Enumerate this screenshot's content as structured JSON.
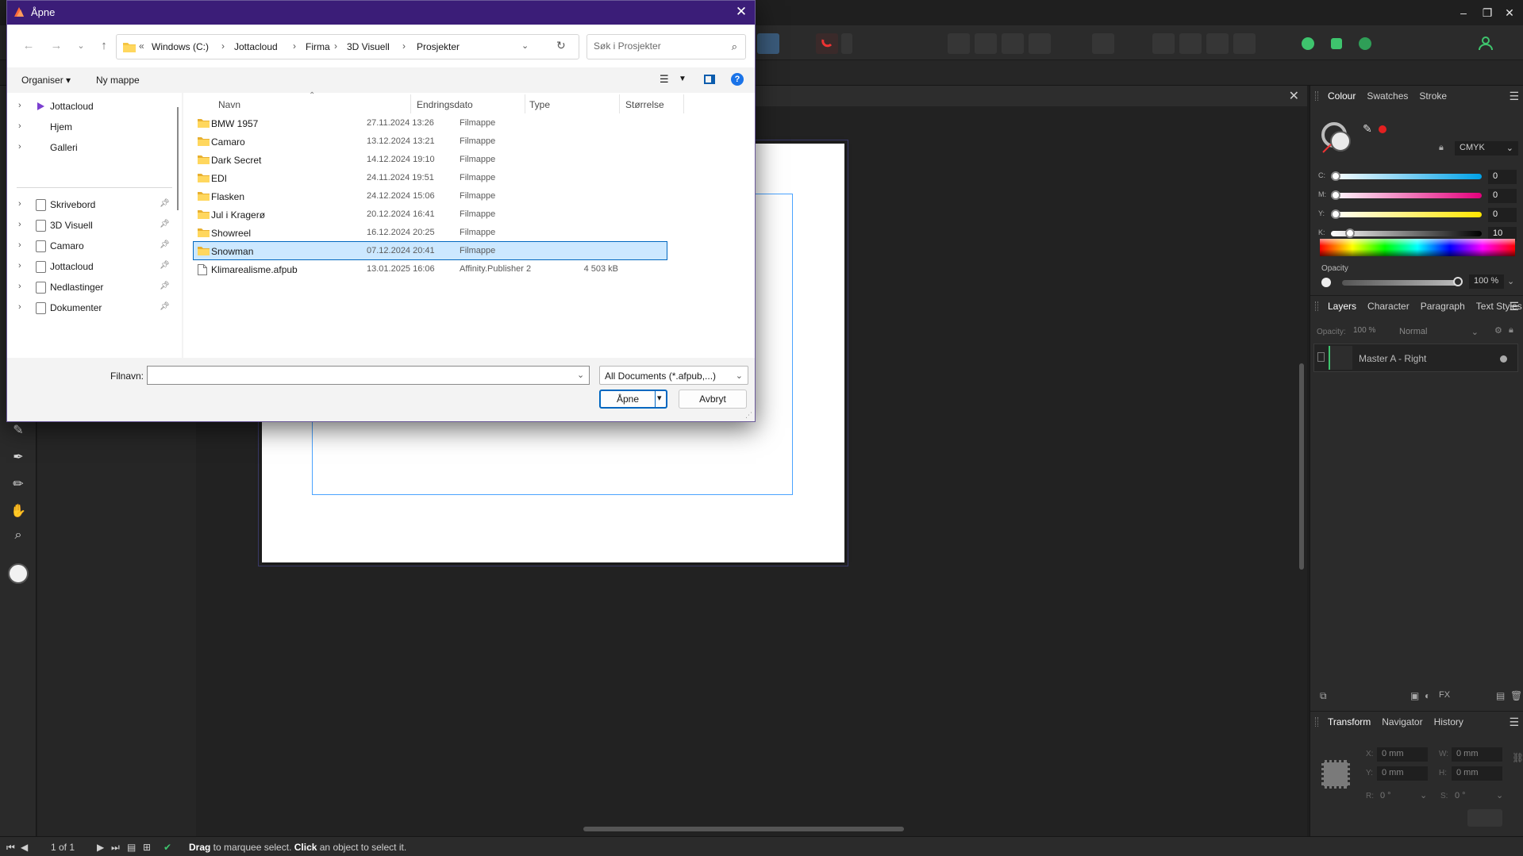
{
  "dialog": {
    "title": "Åpne",
    "breadcrumb": [
      "Windows (C:)",
      "Jottacloud",
      "Firma",
      "3D Visuell",
      "Prosjekter"
    ],
    "breadcrumb_overflow": "«",
    "search_placeholder": "Søk i Prosjekter",
    "commands": {
      "organize": "Organiser ▾",
      "new_folder": "Ny mappe"
    },
    "nav_top": [
      {
        "label": "Jottacloud",
        "icon": "jottacloud-icon"
      },
      {
        "label": "Hjem",
        "icon": "home-icon"
      },
      {
        "label": "Galleri",
        "icon": "gallery-icon"
      }
    ],
    "nav_quick": [
      {
        "label": "Skrivebord",
        "icon": "folder-icon"
      },
      {
        "label": "3D Visuell",
        "icon": "folder-icon"
      },
      {
        "label": "Camaro",
        "icon": "folder-icon"
      },
      {
        "label": "Jottacloud",
        "icon": "folder-icon"
      },
      {
        "label": "Nedlastinger",
        "icon": "folder-icon"
      },
      {
        "label": "Dokumenter",
        "icon": "folder-icon"
      }
    ],
    "columns": {
      "name": "Navn",
      "date": "Endringsdato",
      "type": "Type",
      "size": "Størrelse"
    },
    "files": [
      {
        "name": "BMW 1957",
        "date": "27.11.2024 13:26",
        "type": "Filmappe",
        "size": "",
        "kind": "folder"
      },
      {
        "name": "Camaro",
        "date": "13.12.2024 13:21",
        "type": "Filmappe",
        "size": "",
        "kind": "folder"
      },
      {
        "name": "Dark Secret",
        "date": "14.12.2024 19:10",
        "type": "Filmappe",
        "size": "",
        "kind": "folder"
      },
      {
        "name": "EDI",
        "date": "24.11.2024 19:51",
        "type": "Filmappe",
        "size": "",
        "kind": "folder"
      },
      {
        "name": "Flasken",
        "date": "24.12.2024 15:06",
        "type": "Filmappe",
        "size": "",
        "kind": "folder"
      },
      {
        "name": "Jul i Kragerø",
        "date": "20.12.2024 16:41",
        "type": "Filmappe",
        "size": "",
        "kind": "folder"
      },
      {
        "name": "Showreel",
        "date": "16.12.2024 20:25",
        "type": "Filmappe",
        "size": "",
        "kind": "folder"
      },
      {
        "name": "Snowman",
        "date": "07.12.2024 20:41",
        "type": "Filmappe",
        "size": "",
        "kind": "folder",
        "selected": true
      },
      {
        "name": "Klimarealisme.afpub",
        "date": "13.01.2025 16:06",
        "type": "Affinity.Publisher 2",
        "size": "4 503 kB",
        "kind": "file"
      }
    ],
    "filename_label": "Filnavn:",
    "filename_value": "",
    "filter": "All Documents (*.afpub,...)",
    "open_label": "Åpne",
    "cancel_label": "Avbryt"
  },
  "studio": {
    "colour_tabs": [
      "Colour",
      "Swatches",
      "Stroke"
    ],
    "colour_model": "CMYK",
    "cmyk": [
      {
        "label": "C:",
        "value": "0",
        "level": 0
      },
      {
        "label": "M:",
        "value": "0",
        "level": 0
      },
      {
        "label": "Y:",
        "value": "0",
        "level": 0
      },
      {
        "label": "K:",
        "value": "10",
        "level": 10
      }
    ],
    "opacity_label": "Opacity",
    "opacity_value": "100 %",
    "layers_tabs": [
      "Layers",
      "Character",
      "Paragraph",
      "Text Styles"
    ],
    "layer_opacity_label": "Opacity:",
    "layer_opacity_value": "100 %",
    "blend_mode": "Normal",
    "layer_name": "Master A - Right",
    "transform_tabs": [
      "Transform",
      "Navigator",
      "History"
    ],
    "transform": {
      "x_label": "X:",
      "x": "0 mm",
      "y_label": "Y:",
      "y": "0 mm",
      "w_label": "W:",
      "w": "0 mm",
      "h_label": "H:",
      "h": "0 mm",
      "r_label": "R:",
      "r": "0 °",
      "s_label": "S:",
      "s": "0 °"
    }
  },
  "status": {
    "page": "1 of 1",
    "hint_drag": "Drag",
    "hint_mid": " to marquee select. ",
    "hint_click": "Click",
    "hint_end": " an object to select it."
  },
  "colors": {
    "dialog_title_bg": "#3b1d78",
    "selection_bg": "#cce8ff",
    "selection_border": "#0067c0",
    "folder": "#f4c542",
    "accent_green": "#3ec46d"
  }
}
